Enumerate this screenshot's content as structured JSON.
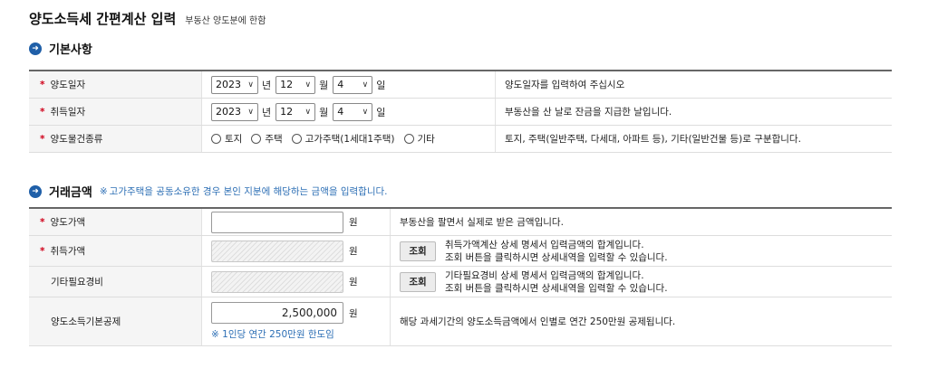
{
  "page": {
    "title": "양도소득세 간편계산 입력",
    "subtitle": "부동산 양도분에 한함"
  },
  "basic": {
    "section_title": "기본사항",
    "transfer_date": {
      "label": "양도일자",
      "year": "2023",
      "year_unit": "년",
      "month": "12",
      "month_unit": "월",
      "day": "4",
      "day_unit": "일",
      "desc": "양도일자를 입력하여 주십시오"
    },
    "acquire_date": {
      "label": "취득일자",
      "year": "2023",
      "year_unit": "년",
      "month": "12",
      "month_unit": "월",
      "day": "4",
      "day_unit": "일",
      "desc": "부동산을 산 날로 잔금을 지급한 날입니다."
    },
    "property_type": {
      "label": "양도물건종류",
      "options": [
        "토지",
        "주택",
        "고가주택(1세대1주택)",
        "기타"
      ],
      "desc": "토지, 주택(일반주택, 다세대, 아파트 등), 기타(일반건물 등)로 구분합니다."
    }
  },
  "amount": {
    "section_title": "거래금액",
    "note_mark": "※",
    "note": "고가주택을 공동소유한 경우 본인 지분에 해당하는 금액을 입력합니다.",
    "transfer_price": {
      "label": "양도가액",
      "value": "",
      "unit": "원",
      "desc": "부동산을 팔면서 실제로 받은 금액입니다."
    },
    "acquire_price": {
      "label": "취득가액",
      "value": "",
      "unit": "원",
      "button": "조회",
      "desc_line1": "취득가액계산 상세 명세서 입력금액의 합계입니다.",
      "desc_line2": "조회 버튼을 클릭하시면 상세내역을 입력할 수 있습니다."
    },
    "other_expense": {
      "label": "기타필요경비",
      "value": "",
      "unit": "원",
      "button": "조회",
      "desc_line1": "기타필요경비 상세 명세서 입력금액의 합계입니다.",
      "desc_line2": "조회 버튼을 클릭하시면 상세내역을 입력할 수 있습니다."
    },
    "basic_deduction": {
      "label": "양도소득기본공제",
      "value": "2,500,000",
      "unit": "원",
      "limit_note": "※ 1인당 연간 250만원 한도임",
      "desc": "해당 과세기간의 양도소득금액에서 인별로 연간 250만원 공제됩니다."
    }
  },
  "required_mark": "*",
  "colors": {
    "accent": "#1f5fa8",
    "note": "#2d6fb5",
    "required": "#d0021b"
  }
}
